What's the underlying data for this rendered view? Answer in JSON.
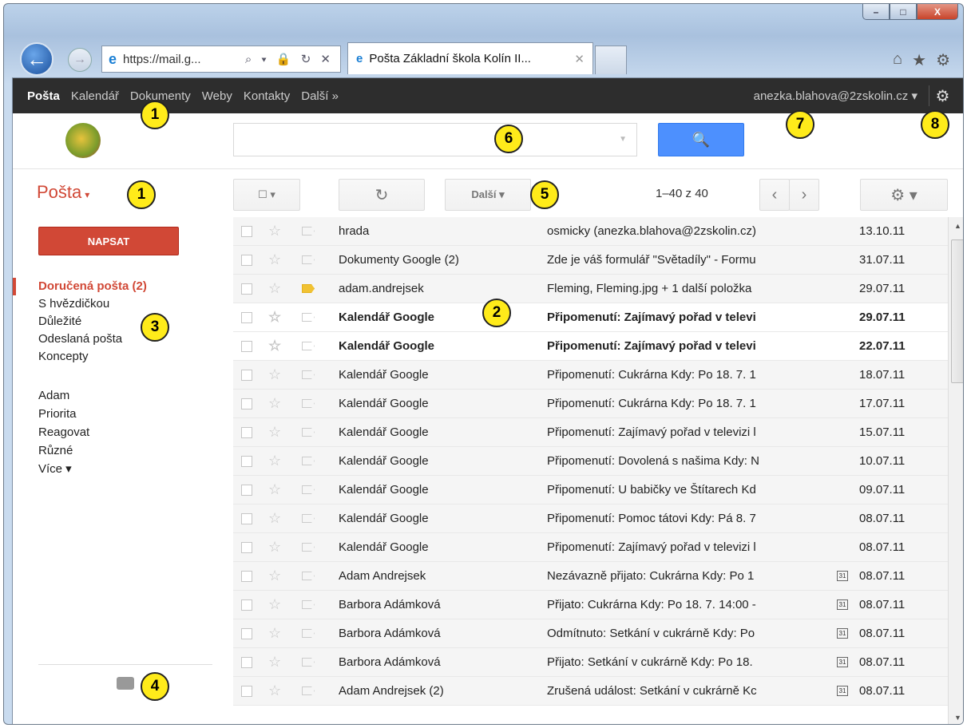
{
  "browser": {
    "window_controls": {
      "minimize": "–",
      "maximize": "□",
      "close": "X"
    },
    "address": "https://mail.g...",
    "address_controls": "⌕ ▾ 🔒 ↻ ✕",
    "tab_title": "Pošta Základní škola Kolín II...",
    "tab_close": "✕",
    "toolbar_icons": [
      "home-icon",
      "star-icon",
      "gear-icon"
    ]
  },
  "gbar": {
    "items": [
      "Pošta",
      "Kalendář",
      "Dokumenty",
      "Weby",
      "Kontakty",
      "Další »"
    ],
    "account": "anezka.blahova@2zskolin.cz ▾"
  },
  "search": {
    "placeholder": ""
  },
  "toolbar": {
    "title": "Pošta",
    "more_label": "Další ▾",
    "count": "1–40 z 40"
  },
  "nav": {
    "compose": "NAPSAT",
    "folders": [
      "Doručená pošta (2)",
      "S hvězdičkou",
      "Důležité",
      "Odeslaná pošta",
      "Koncepty"
    ],
    "labels": [
      "Adam",
      "Priorita",
      "Reagovat",
      "Různé",
      "Více ▾"
    ]
  },
  "messages": [
    {
      "from": "hrada",
      "subject": "osmicky (anezka.blahova@2zskolin.cz)",
      "date": "13.10.11",
      "unread": false,
      "important": false,
      "calendar": false
    },
    {
      "from": "Dokumenty Google (2)",
      "subject": "Zde je váš formulář \"Světadíly\" - Formu",
      "date": "31.07.11",
      "unread": false,
      "important": false,
      "calendar": false
    },
    {
      "from": "adam.andrejsek",
      "subject": "Fleming, Fleming.jpg + 1 další položka",
      "date": "29.07.11",
      "unread": false,
      "important": true,
      "calendar": false
    },
    {
      "from": "Kalendář Google",
      "subject": "Připomenutí: Zajímavý pořad v televi",
      "date": "29.07.11",
      "unread": true,
      "important": false,
      "calendar": false
    },
    {
      "from": "Kalendář Google",
      "subject": "Připomenutí: Zajímavý pořad v televi",
      "date": "22.07.11",
      "unread": true,
      "important": false,
      "calendar": false
    },
    {
      "from": "Kalendář Google",
      "subject": "Připomenutí: Cukrárna Kdy: Po 18. 7. 1",
      "date": "18.07.11",
      "unread": false,
      "important": false,
      "calendar": false
    },
    {
      "from": "Kalendář Google",
      "subject": "Připomenutí: Cukrárna Kdy: Po 18. 7. 1",
      "date": "17.07.11",
      "unread": false,
      "important": false,
      "calendar": false
    },
    {
      "from": "Kalendář Google",
      "subject": "Připomenutí: Zajímavý pořad v televizi l",
      "date": "15.07.11",
      "unread": false,
      "important": false,
      "calendar": false
    },
    {
      "from": "Kalendář Google",
      "subject": "Připomenutí: Dovolená s našima Kdy: N",
      "date": "10.07.11",
      "unread": false,
      "important": false,
      "calendar": false
    },
    {
      "from": "Kalendář Google",
      "subject": "Připomenutí: U babičky ve Štítarech Kd",
      "date": "09.07.11",
      "unread": false,
      "important": false,
      "calendar": false
    },
    {
      "from": "Kalendář Google",
      "subject": "Připomenutí: Pomoc tátovi Kdy: Pá 8. 7",
      "date": "08.07.11",
      "unread": false,
      "important": false,
      "calendar": false
    },
    {
      "from": "Kalendář Google",
      "subject": "Připomenutí: Zajímavý pořad v televizi l",
      "date": "08.07.11",
      "unread": false,
      "important": false,
      "calendar": false
    },
    {
      "from": "Adam Andrejsek",
      "subject": "Nezávazně přijato: Cukrárna Kdy: Po 1",
      "date": "08.07.11",
      "unread": false,
      "important": false,
      "calendar": true
    },
    {
      "from": "Barbora Adámková",
      "subject": "Přijato: Cukrárna Kdy: Po 18. 7. 14:00 -",
      "date": "08.07.11",
      "unread": false,
      "important": false,
      "calendar": true
    },
    {
      "from": "Barbora Adámková",
      "subject": "Odmítnuto: Setkání v cukrárně Kdy: Po",
      "date": "08.07.11",
      "unread": false,
      "important": false,
      "calendar": true
    },
    {
      "from": "Barbora Adámková",
      "subject": "Přijato: Setkání v cukrárně Kdy: Po 18.",
      "date": "08.07.11",
      "unread": false,
      "important": false,
      "calendar": true
    },
    {
      "from": "Adam Andrejsek (2)",
      "subject": "Zrušená událost: Setkání v cukrárně Kc",
      "date": "08.07.11",
      "unread": false,
      "important": false,
      "calendar": true
    }
  ],
  "calendar_icon_text": "31",
  "annotations": [
    "1",
    "1",
    "2",
    "3",
    "4",
    "5",
    "6",
    "7",
    "8"
  ],
  "colors": {
    "accent": "#d14836",
    "search_blue": "#4d90fe",
    "gbar": "#2d2d2d",
    "badge": "#ffeb1a"
  }
}
